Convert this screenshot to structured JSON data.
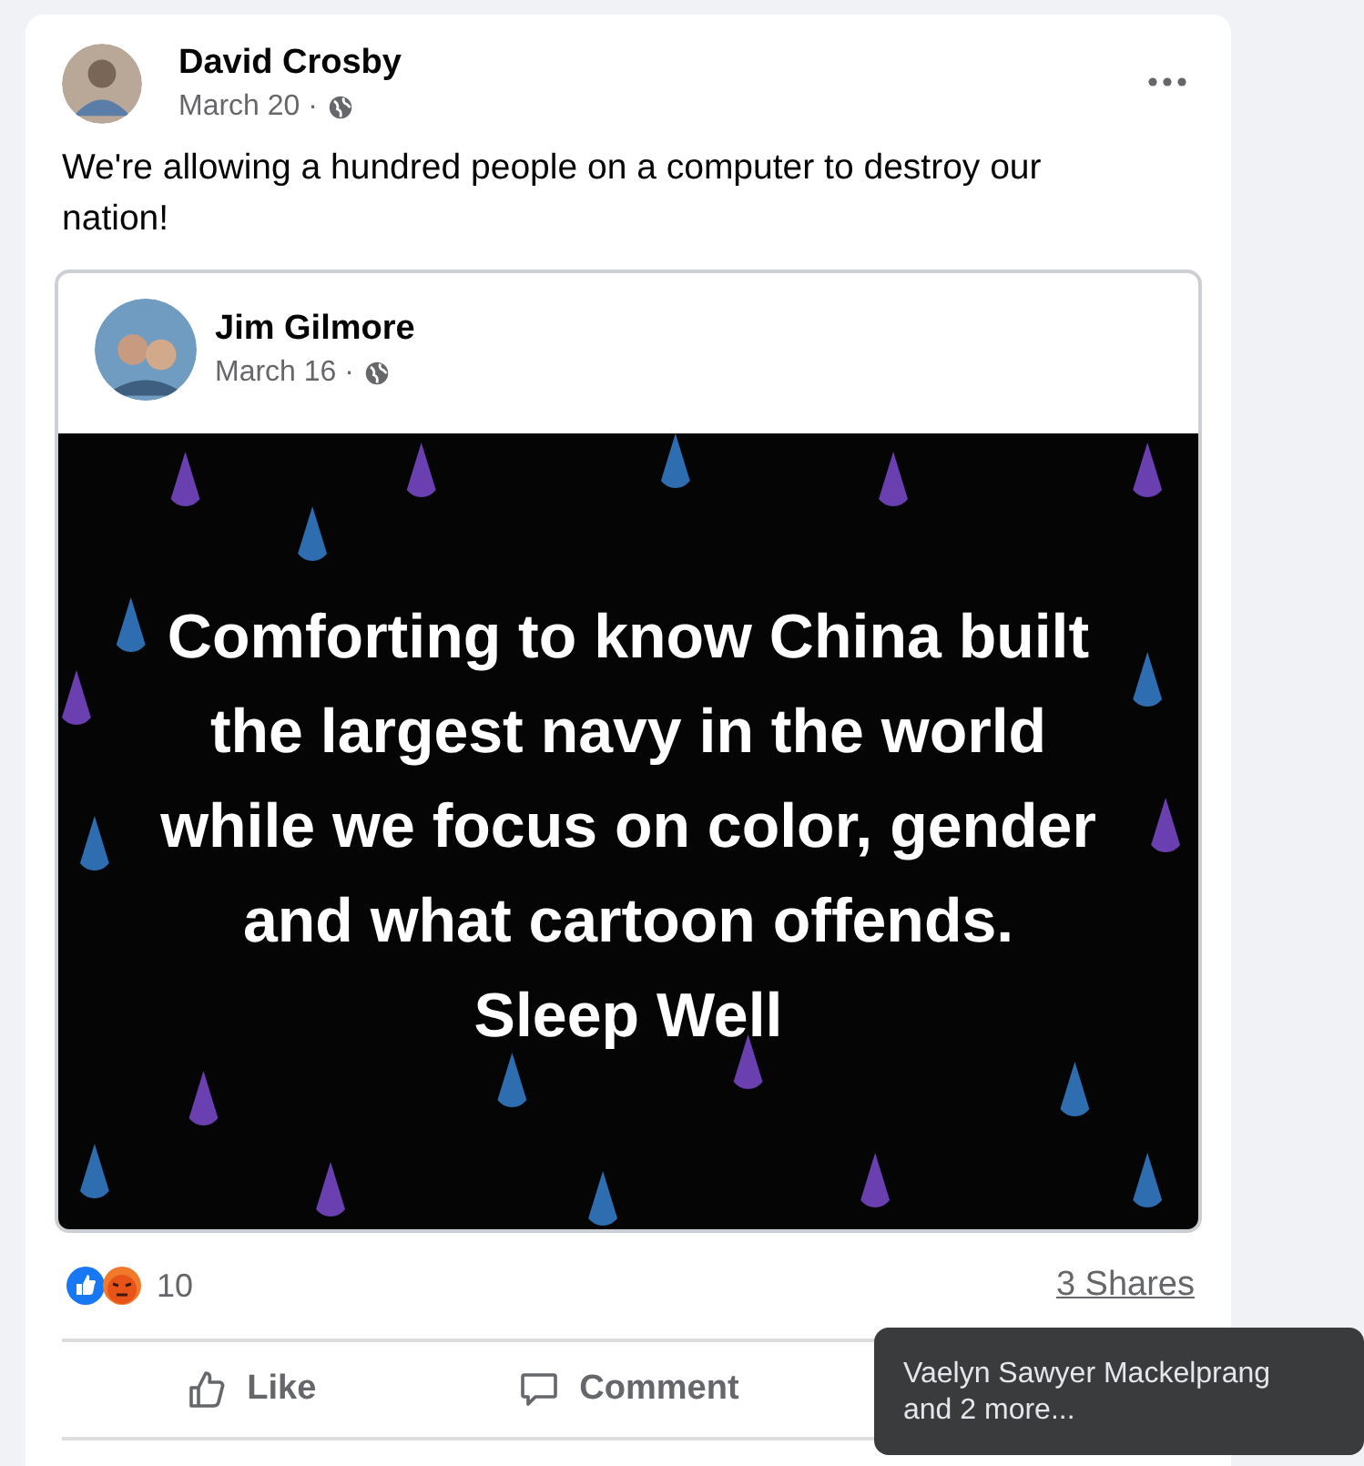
{
  "post": {
    "author": "David Crosby",
    "date": "March 20 ·",
    "text": "We're allowing a hundred people on a computer to destroy our nation!",
    "shared": {
      "author": "Jim Gilmore",
      "date": "March 16 ·",
      "image_text": "Comforting to know China built the largest navy in the world while we focus on color, gender and what cartoon offends. Sleep Well"
    },
    "reaction_count": "10",
    "shares": "3 Shares",
    "actions": [
      {
        "kind": "like",
        "label": "Like"
      },
      {
        "kind": "comment",
        "label": "Comment"
      }
    ]
  },
  "tooltip": {
    "text": "Vaelyn Sawyer Mackelprang and 2 more..."
  }
}
